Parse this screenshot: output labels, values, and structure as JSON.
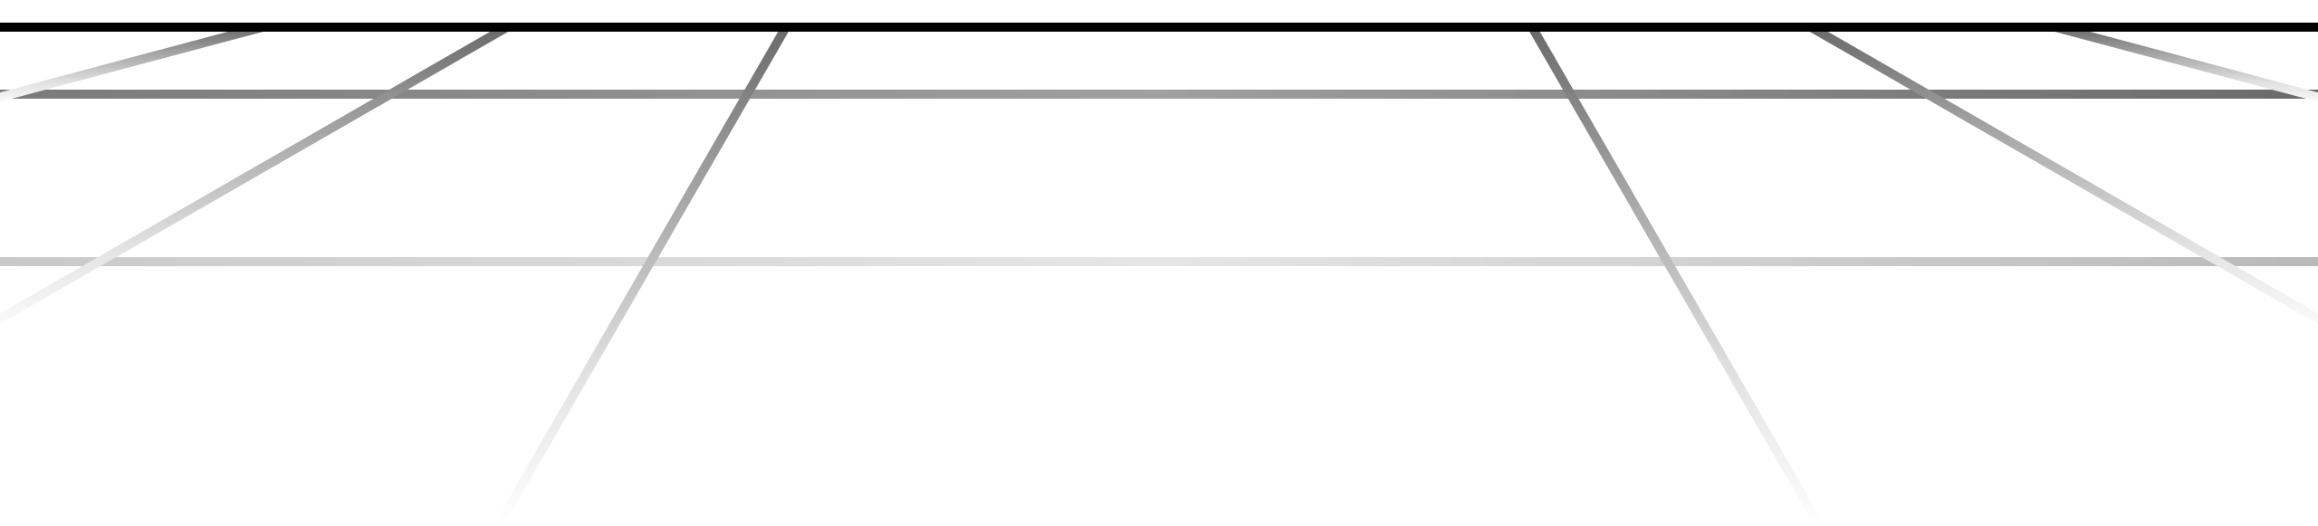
{
  "colors": {
    "background": "#ffffff",
    "horizon_line": "#000000",
    "near_line": "#6f6f6f",
    "far_fade": "#ffffff"
  },
  "scene": {
    "kind": "perspective-floor-grid",
    "description_icon": "grid-floor-icon"
  }
}
